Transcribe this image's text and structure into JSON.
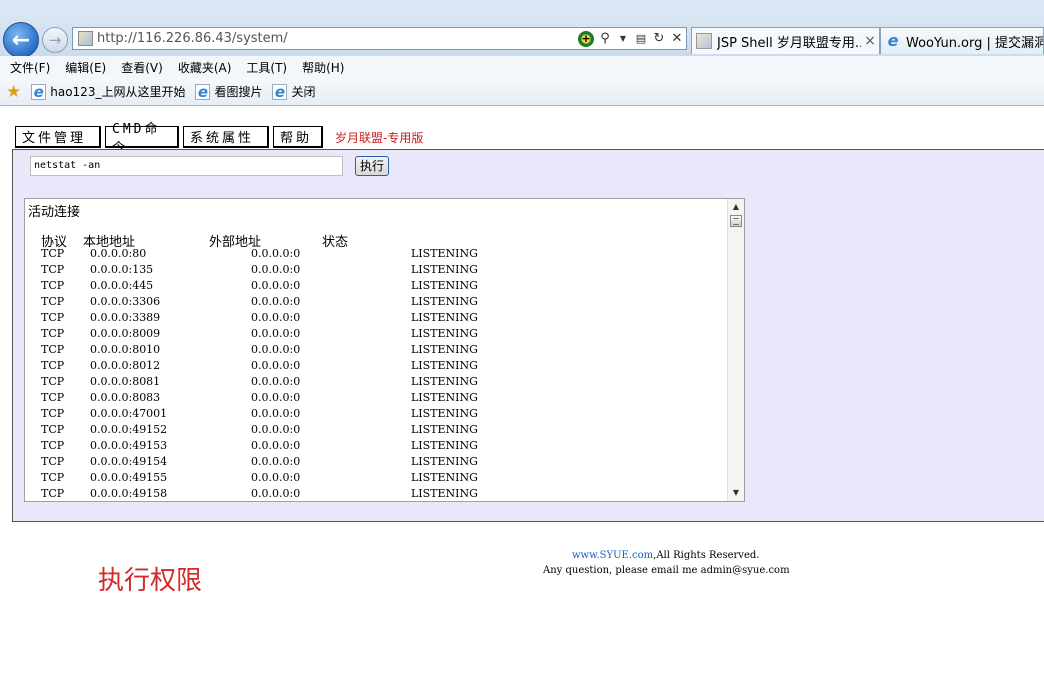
{
  "browser": {
    "address": "http://116.226.86.43/system/",
    "tabs": [
      {
        "title": "JSP Shell 岁月联盟专用...",
        "close": "×"
      },
      {
        "title": "WooYun.org | 提交漏洞"
      }
    ],
    "menu": [
      "文件(F)",
      "编辑(E)",
      "查看(V)",
      "收藏夹(A)",
      "工具(T)",
      "帮助(H)"
    ],
    "favorites": [
      "hao123_上网从这里开始",
      "看图搜片",
      "关闭"
    ]
  },
  "page": {
    "nav": [
      "文件管理",
      "CMD命令",
      "系统属性",
      "帮助"
    ],
    "brand": "岁月联盟-专用版",
    "command_value": "netstat -an",
    "exec_label": "执行",
    "output": {
      "title": "活动连接",
      "headers": {
        "proto": "协议",
        "local": "本地地址",
        "foreign": "外部地址",
        "state": "状态"
      },
      "rows": [
        {
          "proto": "TCP",
          "local": "0.0.0.0:80",
          "foreign": "0.0.0.0:0",
          "state": "LISTENING"
        },
        {
          "proto": "TCP",
          "local": "0.0.0.0:135",
          "foreign": "0.0.0.0:0",
          "state": "LISTENING"
        },
        {
          "proto": "TCP",
          "local": "0.0.0.0:445",
          "foreign": "0.0.0.0:0",
          "state": "LISTENING"
        },
        {
          "proto": "TCP",
          "local": "0.0.0.0:3306",
          "foreign": "0.0.0.0:0",
          "state": "LISTENING"
        },
        {
          "proto": "TCP",
          "local": "0.0.0.0:3389",
          "foreign": "0.0.0.0:0",
          "state": "LISTENING"
        },
        {
          "proto": "TCP",
          "local": "0.0.0.0:8009",
          "foreign": "0.0.0.0:0",
          "state": "LISTENING"
        },
        {
          "proto": "TCP",
          "local": "0.0.0.0:8010",
          "foreign": "0.0.0.0:0",
          "state": "LISTENING"
        },
        {
          "proto": "TCP",
          "local": "0.0.0.0:8012",
          "foreign": "0.0.0.0:0",
          "state": "LISTENING"
        },
        {
          "proto": "TCP",
          "local": "0.0.0.0:8081",
          "foreign": "0.0.0.0:0",
          "state": "LISTENING"
        },
        {
          "proto": "TCP",
          "local": "0.0.0.0:8083",
          "foreign": "0.0.0.0:0",
          "state": "LISTENING"
        },
        {
          "proto": "TCP",
          "local": "0.0.0.0:47001",
          "foreign": "0.0.0.0:0",
          "state": "LISTENING"
        },
        {
          "proto": "TCP",
          "local": "0.0.0.0:49152",
          "foreign": "0.0.0.0:0",
          "state": "LISTENING"
        },
        {
          "proto": "TCP",
          "local": "0.0.0.0:49153",
          "foreign": "0.0.0.0:0",
          "state": "LISTENING"
        },
        {
          "proto": "TCP",
          "local": "0.0.0.0:49154",
          "foreign": "0.0.0.0:0",
          "state": "LISTENING"
        },
        {
          "proto": "TCP",
          "local": "0.0.0.0:49155",
          "foreign": "0.0.0.0:0",
          "state": "LISTENING"
        },
        {
          "proto": "TCP",
          "local": "0.0.0.0:49158",
          "foreign": "0.0.0.0:0",
          "state": "LISTENING"
        }
      ]
    },
    "footer": {
      "link": "www.SYUE.com",
      "rights": ",All Rights Reserved.",
      "contact": "Any question, please email me admin@syue.com"
    },
    "note": "执行权限"
  }
}
